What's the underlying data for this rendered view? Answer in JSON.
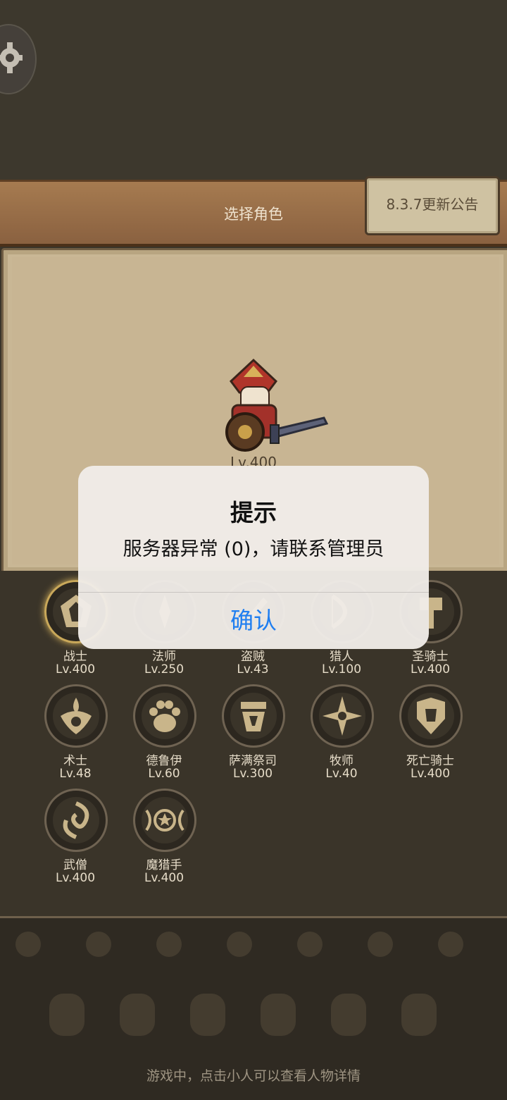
{
  "header": {
    "title": "选择角色",
    "notice_label": "8.3.7更新公告"
  },
  "stage": {
    "character_level": "Lv.400"
  },
  "classes": [
    {
      "name": "战士",
      "level": "Lv.400"
    },
    {
      "name": "法师",
      "level": "Lv.250"
    },
    {
      "name": "盗贼",
      "level": "Lv.43"
    },
    {
      "name": "猎人",
      "level": "Lv.100"
    },
    {
      "name": "圣骑士",
      "level": "Lv.400"
    },
    {
      "name": "术士",
      "level": "Lv.48"
    },
    {
      "name": "德鲁伊",
      "level": "Lv.60"
    },
    {
      "name": "萨满祭司",
      "level": "Lv.300"
    },
    {
      "name": "牧师",
      "level": "Lv.40"
    },
    {
      "name": "死亡骑士",
      "level": "Lv.400"
    },
    {
      "name": "武僧",
      "level": "Lv.400"
    },
    {
      "name": "魔猎手",
      "level": "Lv.400"
    }
  ],
  "footer": {
    "tip": "游戏中，点击小人可以查看人物详情"
  },
  "dialog": {
    "title": "提示",
    "message": "服务器异常 (0)，请联系管理员",
    "confirm_label": "确认"
  },
  "colors": {
    "accent_blue": "#1f7ef0",
    "icon_gold": "#c9b58a",
    "frame_brown": "#6f5c43"
  },
  "icons": [
    "gear-icon",
    "warrior-icon",
    "paw-icon",
    "totem-icon",
    "shuriken-icon",
    "death-knight-icon",
    "monk-icon",
    "demon-hunter-icon"
  ]
}
